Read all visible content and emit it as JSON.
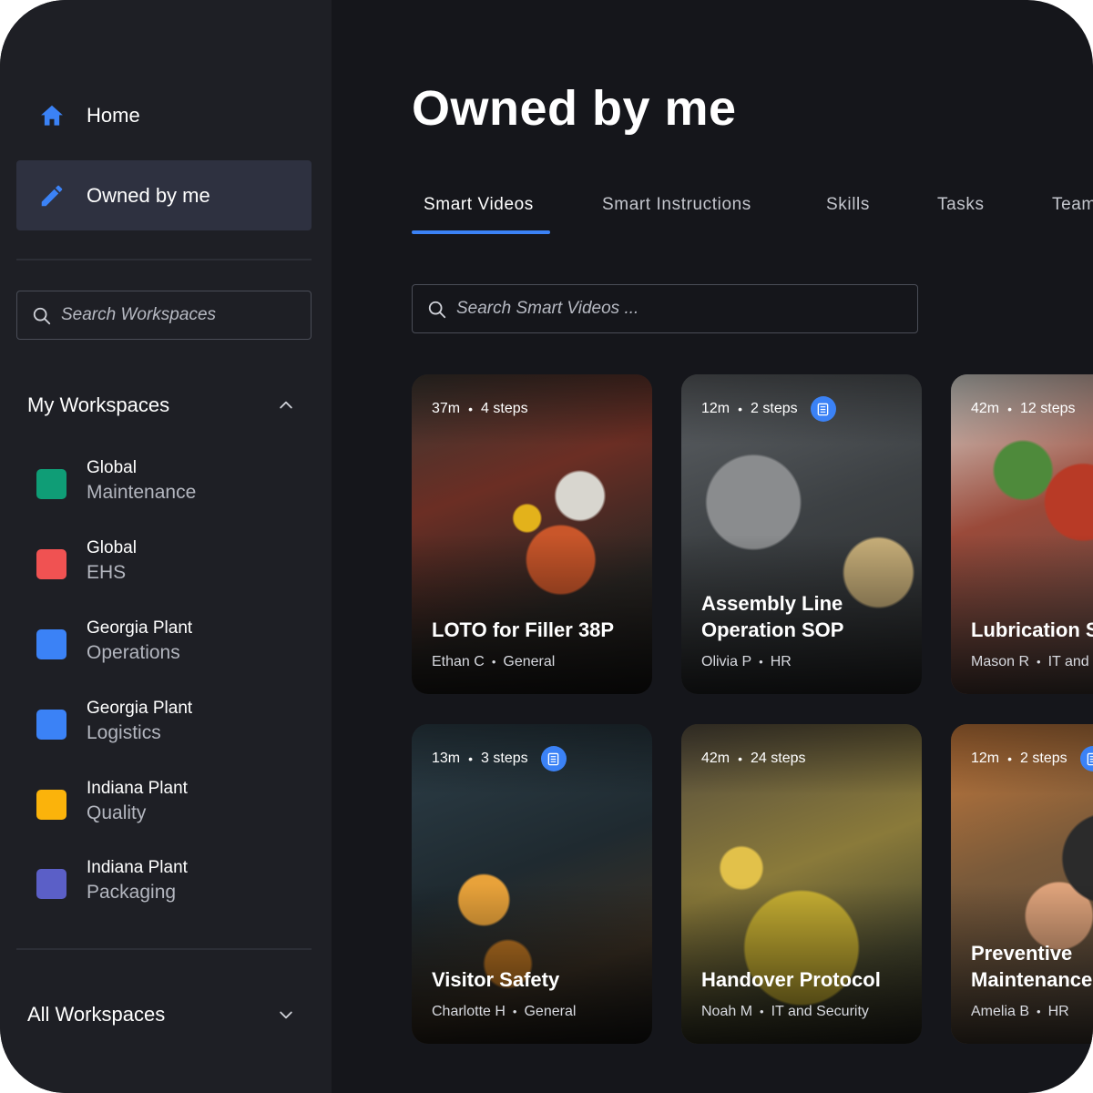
{
  "sidebar": {
    "nav": {
      "home_label": "Home",
      "owned_label": "Owned by me"
    },
    "search": {
      "placeholder": "Search Workspaces"
    },
    "my_workspaces": {
      "title": "My Workspaces",
      "items": [
        {
          "line1": "Global",
          "line2": "Maintenance",
          "color": "#0f9d76"
        },
        {
          "line1": "Global",
          "line2": "EHS",
          "color": "#f05252"
        },
        {
          "line1": "Georgia Plant",
          "line2": "Operations",
          "color": "#3b82f6"
        },
        {
          "line1": "Georgia Plant",
          "line2": "Logistics",
          "color": "#3b82f6"
        },
        {
          "line1": "Indiana Plant",
          "line2": "Quality",
          "color": "#fbb30b"
        },
        {
          "line1": "Indiana Plant",
          "line2": "Packaging",
          "color": "#5b5fc7"
        }
      ]
    },
    "all_workspaces": {
      "title": "All Workspaces"
    }
  },
  "main": {
    "title": "Owned by me",
    "tabs": [
      {
        "label": "Smart Videos",
        "active": true
      },
      {
        "label": "Smart Instructions"
      },
      {
        "label": "Skills"
      },
      {
        "label": "Tasks"
      },
      {
        "label": "Teams"
      }
    ],
    "search": {
      "placeholder": "Search Smart Videos ..."
    },
    "cards": [
      {
        "duration": "37m",
        "steps": "4 steps",
        "has_doc": false,
        "title": "LOTO for Filler 38P",
        "author": "Ethan C",
        "workspace": "General"
      },
      {
        "duration": "12m",
        "steps": "2 steps",
        "has_doc": true,
        "title": "Assembly Line Operation SOP",
        "author": "Olivia P",
        "workspace": "HR"
      },
      {
        "duration": "42m",
        "steps": "12 steps",
        "has_doc": false,
        "title": "Lubrication Schedule",
        "author": "Mason R",
        "workspace": "IT and Security"
      },
      {
        "duration": "13m",
        "steps": "3 steps",
        "has_doc": true,
        "title": "Visitor Safety",
        "author": "Charlotte H",
        "workspace": "General"
      },
      {
        "duration": "42m",
        "steps": "24 steps",
        "has_doc": false,
        "title": "Handover Protocol",
        "author": "Noah M",
        "workspace": "IT and Security"
      },
      {
        "duration": "12m",
        "steps": "2 steps",
        "has_doc": true,
        "title": "Preventive Maintenance",
        "author": "Amelia B",
        "workspace": "HR"
      }
    ]
  },
  "colors": {
    "accent": "#3b82f6",
    "sidebar_bg": "#1e1f25",
    "main_bg": "#15161b",
    "active_nav_bg": "#2e3140"
  },
  "icons": [
    "home-icon",
    "pencil-icon",
    "search-icon",
    "chevron-up-icon",
    "chevron-down-icon",
    "document-icon"
  ]
}
